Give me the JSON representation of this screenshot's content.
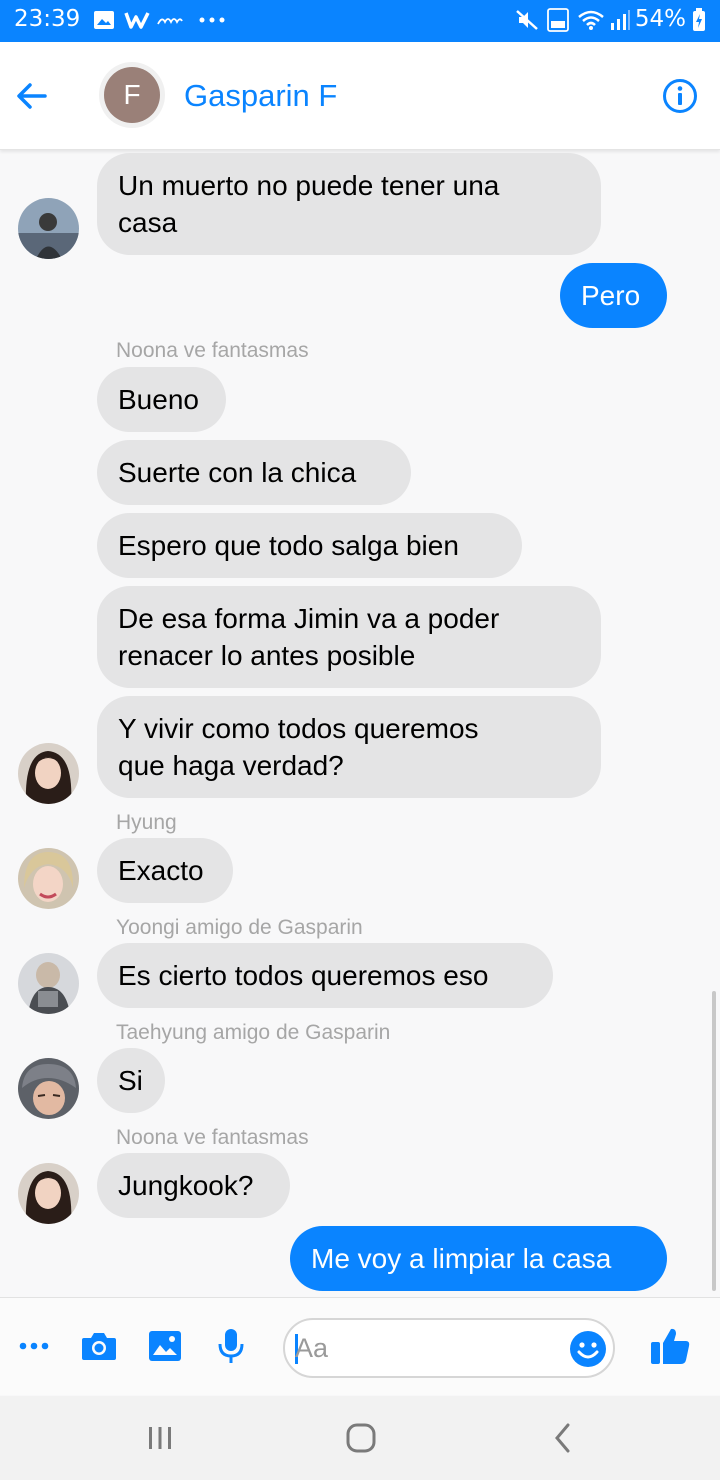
{
  "status_bar": {
    "time": "23:39",
    "battery_text": "54%",
    "network_label": "Vo) 4G",
    "left_icons": [
      "gallery-icon",
      "wattpad-w-icon",
      "play-text-icon",
      "more-dots-icon"
    ],
    "right_icons": [
      "mute-icon",
      "volte-4g-icon",
      "wifi-icon",
      "signal-icon",
      "battery-icon"
    ]
  },
  "header": {
    "avatar_letter": "F",
    "contact_name": "Gasparin F"
  },
  "messages": [
    {
      "id": "m1",
      "direction": "in",
      "text": "Un muerto no puede tener una\ncasa"
    },
    {
      "id": "m2",
      "direction": "out",
      "text": "Pero"
    },
    {
      "id": "s1",
      "sender": "Noona ve fantasmas"
    },
    {
      "id": "m3",
      "direction": "in",
      "text": "Bueno"
    },
    {
      "id": "m4",
      "direction": "in",
      "text": "Suerte con la chica"
    },
    {
      "id": "m5",
      "direction": "in",
      "text": "Espero que todo salga bien"
    },
    {
      "id": "m6",
      "direction": "in",
      "text": "De esa forma Jimin va a poder\nrenacer lo antes posible"
    },
    {
      "id": "m7",
      "direction": "in",
      "text": "Y vivir como todos queremos\nque haga verdad?"
    },
    {
      "id": "s2",
      "sender": "Hyung"
    },
    {
      "id": "m8",
      "direction": "in",
      "text": "Exacto"
    },
    {
      "id": "s3",
      "sender": "Yoongi amigo de Gasparin"
    },
    {
      "id": "m9",
      "direction": "in",
      "text": "Es cierto todos queremos eso"
    },
    {
      "id": "s4",
      "sender": "Taehyung amigo de Gasparin"
    },
    {
      "id": "m10",
      "direction": "in",
      "text": "Si"
    },
    {
      "id": "s5",
      "sender": "Noona ve fantasmas"
    },
    {
      "id": "m11",
      "direction": "in",
      "text": "Jungkook?"
    },
    {
      "id": "m12",
      "direction": "out",
      "text": "Me voy a limpiar la casa"
    }
  ],
  "composer": {
    "placeholder": "Aa",
    "value": ""
  },
  "colors": {
    "accent": "#0a84ff",
    "incoming_bubble": "#e4e4e5",
    "sender_label": "#a6a6a6",
    "background": "#f8f8f9"
  }
}
